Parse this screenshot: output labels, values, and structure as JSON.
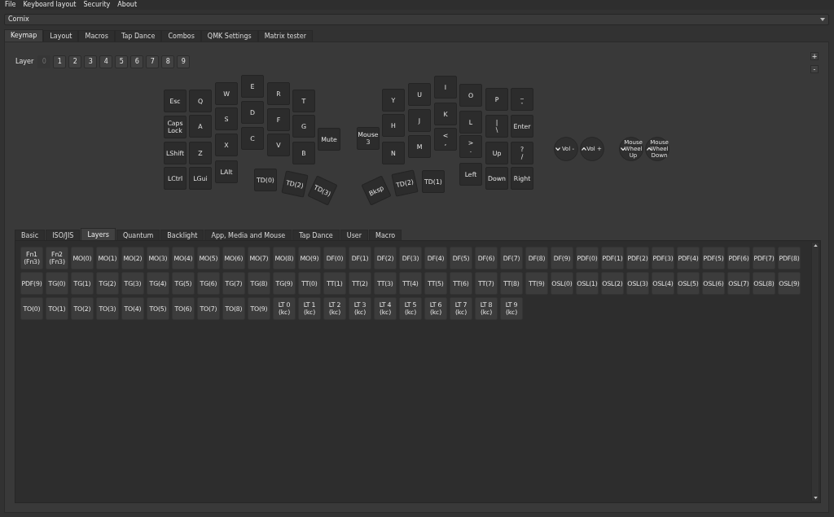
{
  "menu": [
    "File",
    "Keyboard layout",
    "Security",
    "About"
  ],
  "keyboard_select": {
    "value": "Cornix"
  },
  "tabs": [
    {
      "label": "Keymap",
      "selected": true
    },
    {
      "label": "Layout",
      "selected": false
    },
    {
      "label": "Macros",
      "selected": false
    },
    {
      "label": "Tap Dance",
      "selected": false
    },
    {
      "label": "Combos",
      "selected": false
    },
    {
      "label": "QMK Settings",
      "selected": false
    },
    {
      "label": "Matrix tester",
      "selected": false
    }
  ],
  "layers": {
    "label": "Layer",
    "buttons": [
      {
        "label": "0",
        "selected": true
      },
      {
        "label": "1",
        "selected": false
      },
      {
        "label": "2",
        "selected": false
      },
      {
        "label": "3",
        "selected": false
      },
      {
        "label": "4",
        "selected": false
      },
      {
        "label": "5",
        "selected": false
      },
      {
        "label": "6",
        "selected": false
      },
      {
        "label": "7",
        "selected": false
      },
      {
        "label": "8",
        "selected": false
      },
      {
        "label": "9",
        "selected": false
      }
    ]
  },
  "scale_buttons": [
    "+",
    "-"
  ],
  "keyboard": {
    "left_half": [
      "Esc",
      "Q",
      "W",
      "E",
      "R",
      "T",
      "Caps Lock",
      "A",
      "S",
      "D",
      "F",
      "G",
      "Mute",
      "LShift",
      "Z",
      "X",
      "C",
      "V",
      "B",
      "LCtrl",
      "LGui",
      "LAlt",
      "TD(0)",
      "TD(2)",
      "TD(3)"
    ],
    "right_half": [
      "Y",
      "U",
      "I",
      "O",
      "P",
      "_\n-",
      "Mouse 3",
      "H",
      "J",
      "K",
      "L",
      "|\n\\",
      "Enter",
      "N",
      "M",
      "<\n,",
      ">\n.",
      "Up",
      "?\n/",
      "Bksp",
      "TD(2)",
      "TD(1)",
      "Left",
      "Down",
      "Right"
    ],
    "encoders": [
      {
        "label": "Vol -",
        "kind": "down"
      },
      {
        "label": "Vol +",
        "kind": "up"
      },
      {
        "label": "Mouse Wheel Up",
        "kind": "down"
      },
      {
        "label": "Mouse Wheel Down",
        "kind": "up"
      }
    ]
  },
  "keycode_tabs": [
    {
      "label": "Basic",
      "selected": false
    },
    {
      "label": "ISO/JIS",
      "selected": false
    },
    {
      "label": "Layers",
      "selected": true
    },
    {
      "label": "Quantum",
      "selected": false
    },
    {
      "label": "Backlight",
      "selected": false
    },
    {
      "label": "App, Media and Mouse",
      "selected": false
    },
    {
      "label": "Tap Dance",
      "selected": false
    },
    {
      "label": "User",
      "selected": false
    },
    {
      "label": "Macro",
      "selected": false
    }
  ],
  "keycodes": [
    "Fn1 (Fn3)",
    "Fn2 (Fn3)",
    "MO(0)",
    "MO(1)",
    "MO(2)",
    "MO(3)",
    "MO(4)",
    "MO(5)",
    "MO(6)",
    "MO(7)",
    "MO(8)",
    "MO(9)",
    "DF(0)",
    "DF(1)",
    "DF(2)",
    "DF(3)",
    "DF(4)",
    "DF(5)",
    "DF(6)",
    "DF(7)",
    "DF(8)",
    "DF(9)",
    "PDF(0)",
    "PDF(1)",
    "PDF(2)",
    "PDF(3)",
    "PDF(4)",
    "PDF(5)",
    "PDF(6)",
    "PDF(7)",
    "PDF(8)",
    "PDF(9)",
    "TG(0)",
    "TG(1)",
    "TG(2)",
    "TG(3)",
    "TG(4)",
    "TG(5)",
    "TG(6)",
    "TG(7)",
    "TG(8)",
    "TG(9)",
    "TT(0)",
    "TT(1)",
    "TT(2)",
    "TT(3)",
    "TT(4)",
    "TT(5)",
    "TT(6)",
    "TT(7)",
    "TT(8)",
    "TT(9)",
    "OSL(0)",
    "OSL(1)",
    "OSL(2)",
    "OSL(3)",
    "OSL(4)",
    "OSL(5)",
    "OSL(6)",
    "OSL(7)",
    "OSL(8)",
    "OSL(9)",
    "TO(0)",
    "TO(1)",
    "TO(2)",
    "TO(3)",
    "TO(4)",
    "TO(5)",
    "TO(6)",
    "TO(7)",
    "TO(8)",
    "TO(9)",
    "LT 0 (kc)",
    "LT 1 (kc)",
    "LT 2 (kc)",
    "LT 3 (kc)",
    "LT 4 (kc)",
    "LT 5 (kc)",
    "LT 6 (kc)",
    "LT 7 (kc)",
    "LT 8 (kc)",
    "LT 9 (kc)"
  ]
}
